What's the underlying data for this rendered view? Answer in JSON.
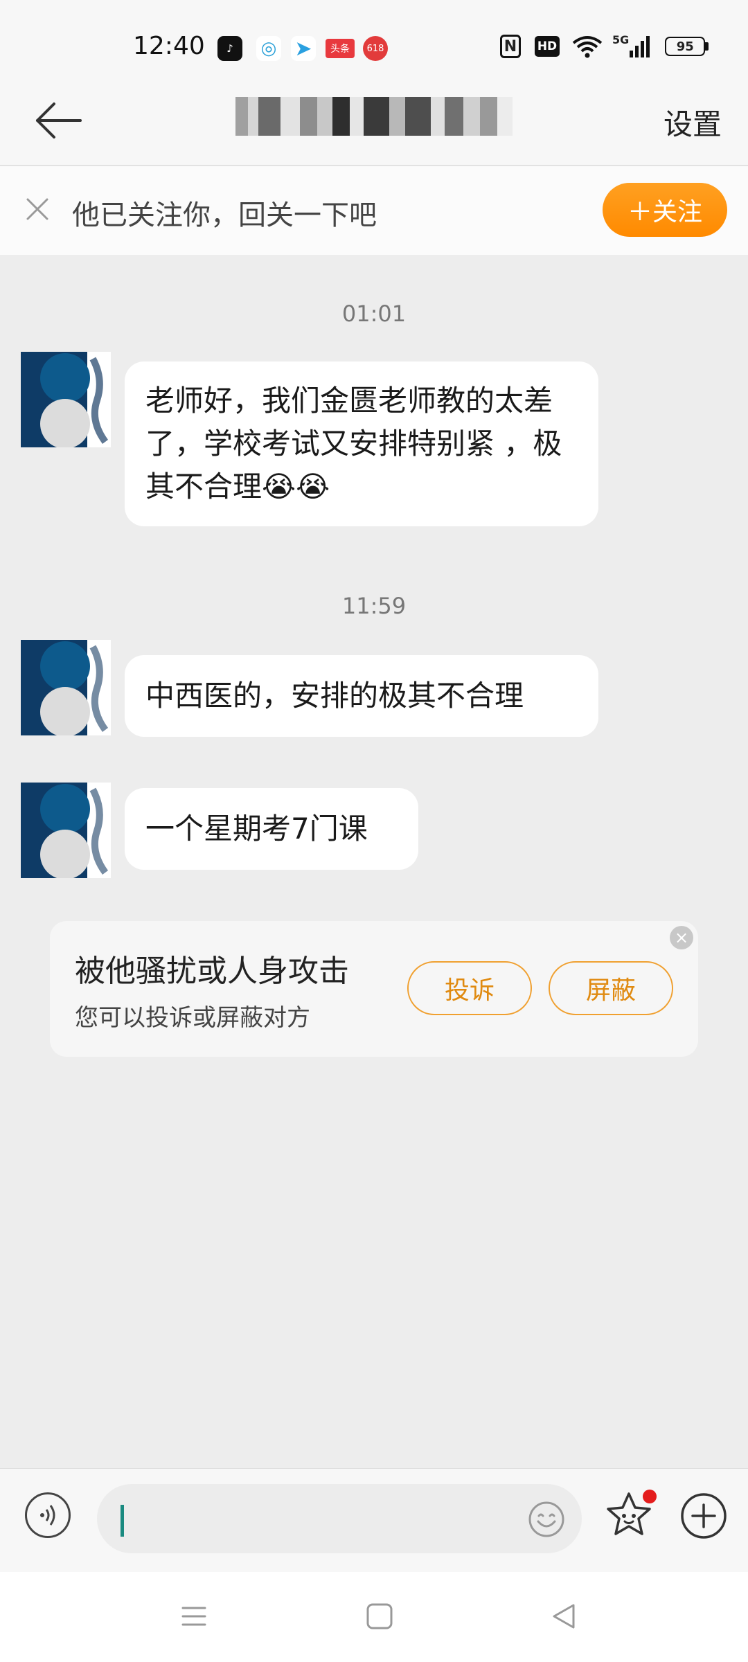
{
  "status_bar": {
    "time": "12:40",
    "apps": [
      {
        "name": "tiktok",
        "label": "♪",
        "color": "#111111"
      },
      {
        "name": "china-mobile",
        "label": "◎",
        "color": "#2aa0d8"
      },
      {
        "name": "telegram",
        "label": "➤",
        "color": "#2aa0e0"
      },
      {
        "name": "toutiao",
        "label": "头条",
        "color": "#e8393e"
      },
      {
        "name": "jd-618",
        "label": "618",
        "color": "#e23b3b"
      }
    ],
    "nfc": "N",
    "hd": "HD",
    "network": "5G",
    "battery": "95"
  },
  "header": {
    "settings_label": "设置"
  },
  "follow_bar": {
    "text": "他已关注你，回关一下吧",
    "button_label": "＋关注",
    "accent": "#ff8a00"
  },
  "chat": {
    "groups": [
      {
        "time": "01:01",
        "messages": [
          "老师好，我们金匮老师教的太差了，学校考试又安排特别紧 ，极其不合理😭😭"
        ]
      },
      {
        "time": "11:59",
        "messages": [
          "中西医的，安排的极其不合理",
          "一个星期考7门课"
        ]
      }
    ]
  },
  "harass_notice": {
    "title": "被他骚扰或人身攻击",
    "subtitle": "您可以投诉或屏蔽对方",
    "complain_label": "投诉",
    "block_label": "屏蔽",
    "close_icon": "×"
  },
  "input_bar": {
    "placeholder": ""
  },
  "nav": {
    "menu_icon": "≡",
    "home_icon": "□",
    "back_icon": "◁"
  }
}
